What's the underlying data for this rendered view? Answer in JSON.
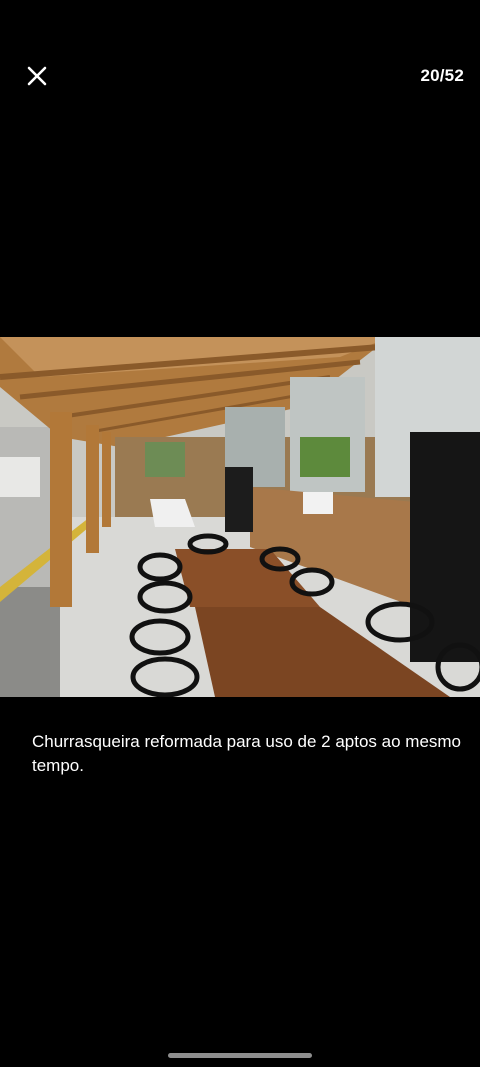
{
  "header": {
    "close_icon": "close-icon",
    "counter": "20/52"
  },
  "photo": {
    "description_icon": "listing-photo"
  },
  "caption": {
    "text": "Churrasqueira reformada para uso de 2 aptos ao mesmo tempo."
  },
  "colors": {
    "background": "#000000",
    "text": "#ffffff"
  }
}
